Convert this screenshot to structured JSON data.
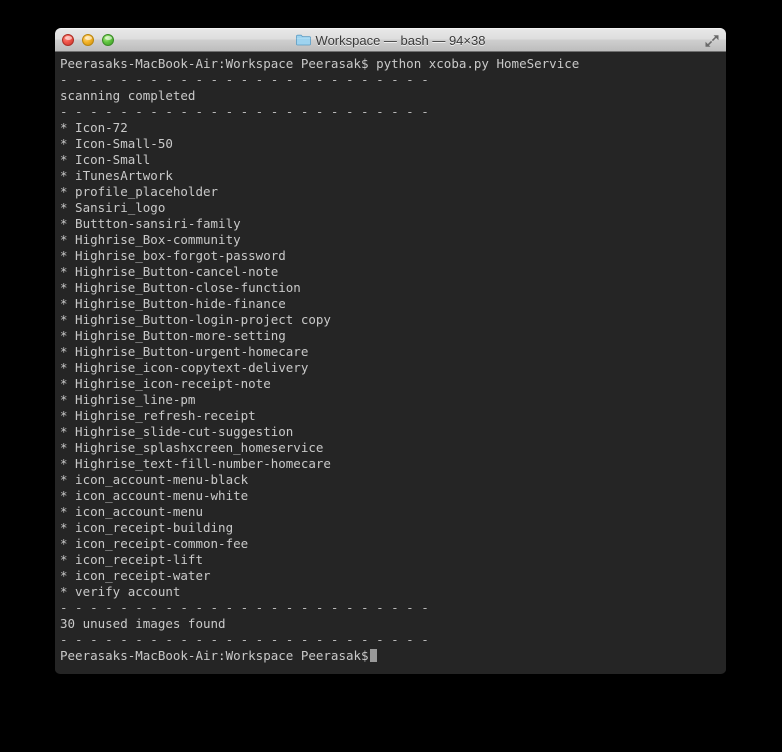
{
  "window": {
    "title": "Workspace — bash — 94×38",
    "folder_icon": "folder-icon",
    "traffic_lights": [
      {
        "name": "close",
        "color": "#f1554a"
      },
      {
        "name": "minimize",
        "color": "#f5b427"
      },
      {
        "name": "zoom",
        "color": "#61c540"
      }
    ],
    "fullscreen_icon": "fullscreen-arrows-icon"
  },
  "terminal": {
    "prompt": "Peerasaks-MacBook-Air:Workspace Peerasak$",
    "command": "python xcoba.py HomeService",
    "command_line": "Peerasaks-MacBook-Air:Workspace Peerasak$ python xcoba.py HomeService",
    "separator": "- - - - - - - - - - - - - - - - - - - - - - - - -",
    "status_scanning": "scanning completed",
    "summary": "30 unused images found",
    "final_prompt": "Peerasaks-MacBook-Air:Workspace Peerasak$",
    "unused_images": [
      "* Icon-72",
      "* Icon-Small-50",
      "* Icon-Small",
      "* iTunesArtwork",
      "* profile_placeholder",
      "* Sansiri_logo",
      "* Buttton-sansiri-family",
      "* Highrise_Box-community",
      "* Highrise_box-forgot-password",
      "* Highrise_Button-cancel-note",
      "* Highrise_Button-close-function",
      "* Highrise_Button-hide-finance",
      "* Highrise_Button-login-project copy",
      "* Highrise_Button-more-setting",
      "* Highrise_Button-urgent-homecare",
      "* Highrise_icon-copytext-delivery",
      "* Highrise_icon-receipt-note",
      "* Highrise_line-pm",
      "* Highrise_refresh-receipt",
      "* Highrise_slide-cut-suggestion",
      "* Highrise_splashxcreen_homeservice",
      "* Highrise_text-fill-number-homecare",
      "* icon_account-menu-black",
      "* icon_account-menu-white",
      "* icon_account-menu",
      "* icon_receipt-building",
      "* icon_receipt-common-fee",
      "* icon_receipt-lift",
      "* icon_receipt-water",
      "* verify account"
    ]
  },
  "colors": {
    "terminal_background": "#252525",
    "terminal_text": "#c9c9c9",
    "desktop_background": "#000000",
    "cursor": "#9a9a9a"
  }
}
